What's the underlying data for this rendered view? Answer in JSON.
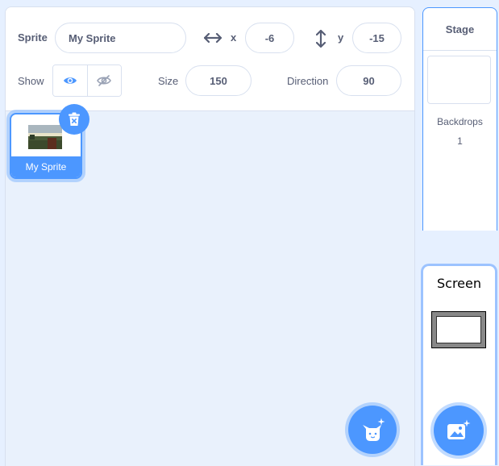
{
  "sprite_info": {
    "sprite_label": "Sprite",
    "sprite_name_value": "My Sprite",
    "x_label": "x",
    "x_value": "-6",
    "y_label": "y",
    "y_value": "-15",
    "show_label": "Show",
    "size_label": "Size",
    "size_value": "150",
    "direction_label": "Direction",
    "direction_value": "90"
  },
  "sprite_list": {
    "items": [
      {
        "name": "My Sprite",
        "selected": true
      }
    ]
  },
  "stage": {
    "header": "Stage",
    "backdrops_label": "Backdrops",
    "backdrops_count": "1"
  },
  "screen": {
    "title": "Screen"
  },
  "icons": {
    "x_arrow": "horizontal-arrows-icon",
    "y_arrow": "vertical-arrows-icon",
    "show_visible": "eye-icon",
    "show_hidden": "eye-slash-icon",
    "delete": "trash-icon",
    "add_sprite": "cat-plus-icon",
    "add_backdrop": "image-plus-icon"
  },
  "colors": {
    "accent": "#4c97ff",
    "text": "#575e75",
    "background": "#e6f0ff",
    "border": "#d8e0ef"
  }
}
